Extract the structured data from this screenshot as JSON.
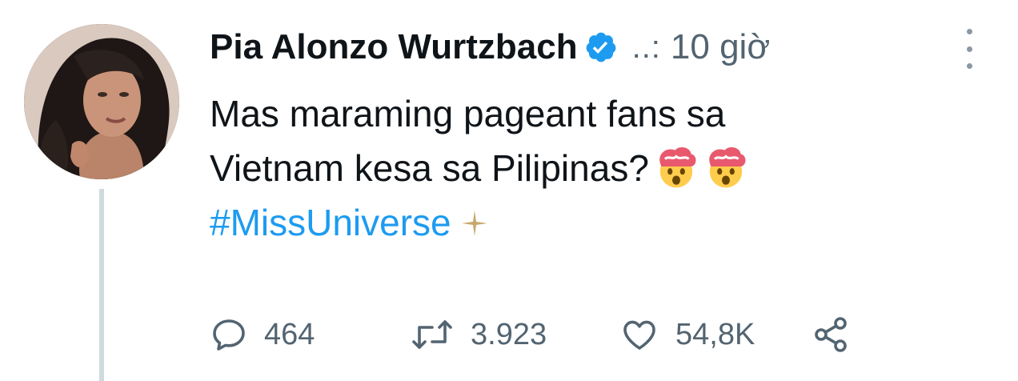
{
  "tweet": {
    "author": {
      "display_name": "Pia Alonzo Wurtzbach",
      "verified_icon": "verified-badge-icon",
      "handle_truncated": "..:",
      "timestamp": "10 giờ"
    },
    "menu_icon": "more-vertical-icon",
    "text": {
      "line1": "Mas maraming pageant fans sa",
      "line2": "Vietnam kesa sa Pilipinas?",
      "emoji": "exploding-head-emoji",
      "hashtag": "#MissUniverse",
      "hashtag_emoji": "sparkle-emoji"
    },
    "actions": {
      "reply_icon": "reply-icon",
      "reply_count": "464",
      "retweet_icon": "retweet-icon",
      "retweet_count": "3.923",
      "like_icon": "heart-icon",
      "like_count": "54,8K",
      "share_icon": "share-icon"
    },
    "colors": {
      "text": "#0f1419",
      "secondary": "#536471",
      "link": "#1d9bf0",
      "verified": "#1d9bf0",
      "thread_line": "#cfd9de"
    }
  }
}
